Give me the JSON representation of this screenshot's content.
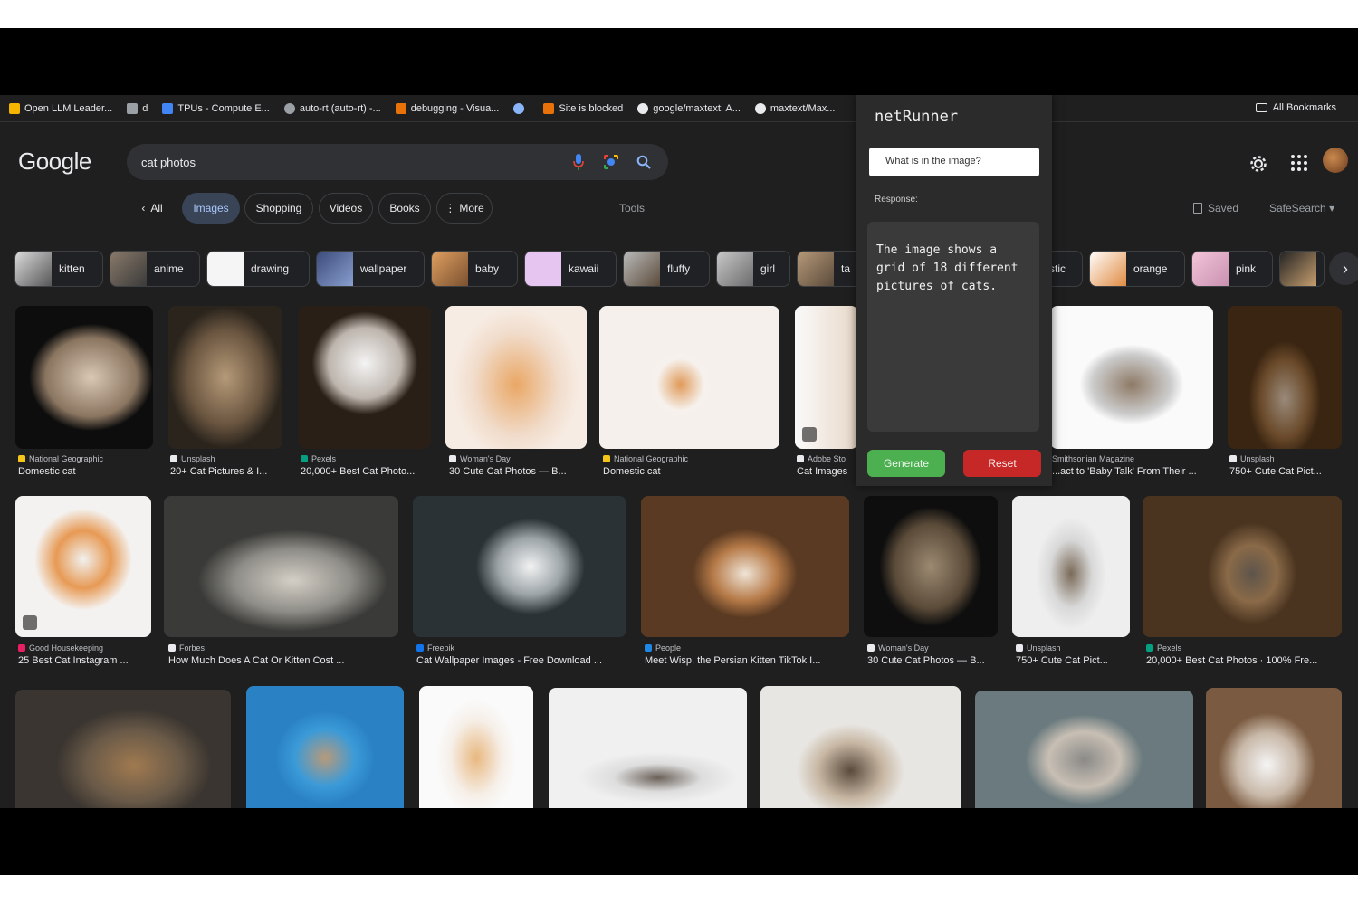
{
  "bookmarks": [
    {
      "label": "Open LLM Leader...",
      "color": "#f5b400"
    },
    {
      "label": "d",
      "color": "#9aa0a6"
    },
    {
      "label": "TPUs - Compute E...",
      "color": "#4285f4"
    },
    {
      "label": "auto-rt (auto-rt) -...",
      "color": "#9aa0a6"
    },
    {
      "label": "debugging - Visua...",
      "color": "#e8710a"
    },
    {
      "label": "",
      "color": "#8ab4f8"
    },
    {
      "label": "Site is blocked",
      "color": "#e8710a"
    },
    {
      "label": "google/maxtext: A...",
      "color": "#e8eaed"
    },
    {
      "label": "maxtext/Max...",
      "color": "#e8eaed"
    }
  ],
  "all_bookmarks": "All Bookmarks",
  "logo": "Google",
  "search": {
    "value": "cat photos"
  },
  "tabs": {
    "all": "All",
    "images": "Images",
    "shopping": "Shopping",
    "videos": "Videos",
    "books": "Books",
    "more": "More",
    "tools": "Tools",
    "saved": "Saved",
    "safesearch": "SafeSearch"
  },
  "chips": [
    "kitten",
    "anime",
    "drawing",
    "wallpaper",
    "baby",
    "kawaii",
    "fluffy",
    "girl",
    "ta",
    "stic",
    "orange",
    "pink"
  ],
  "results": [
    {
      "source": "National Geographic",
      "title": "Domestic cat",
      "src_color": "#f5c518"
    },
    {
      "source": "Unsplash",
      "title": "20+ Cat Pictures & I...",
      "src_color": "#e8eaed"
    },
    {
      "source": "Pexels",
      "title": "20,000+ Best Cat Photo...",
      "src_color": "#05a081"
    },
    {
      "source": "Woman's Day",
      "title": "30 Cute Cat Photos — B...",
      "src_color": "#e8eaed"
    },
    {
      "source": "National Geographic",
      "title": "Domestic cat",
      "src_color": "#f5c518"
    },
    {
      "source": "Adobe Sto",
      "title": "Cat Images",
      "src_color": "#e8eaed"
    },
    {
      "source": "Smithsonian Magazine",
      "title": "...act to 'Baby Talk' From Their ...",
      "src_color": "#e8eaed"
    },
    {
      "source": "Unsplash",
      "title": "750+ Cute Cat Pict...",
      "src_color": "#e8eaed"
    },
    {
      "source": "Good Housekeeping",
      "title": "25 Best Cat Instagram ...",
      "src_color": "#e91e63"
    },
    {
      "source": "Forbes",
      "title": "How Much Does A Cat Or Kitten Cost ...",
      "src_color": "#e8eaed"
    },
    {
      "source": "Freepik",
      "title": "Cat Wallpaper Images - Free Download ...",
      "src_color": "#1273eb"
    },
    {
      "source": "People",
      "title": "Meet Wisp, the Persian Kitten TikTok I...",
      "src_color": "#1e88e5"
    },
    {
      "source": "Woman's Day",
      "title": "30 Cute Cat Photos — B...",
      "src_color": "#e8eaed"
    },
    {
      "source": "Unsplash",
      "title": "750+ Cute Cat Pict...",
      "src_color": "#e8eaed"
    },
    {
      "source": "Pexels",
      "title": "20,000+ Best Cat Photos · 100% Fre...",
      "src_color": "#05a081"
    }
  ],
  "panel": {
    "title": "netRunner",
    "input_value": "What is in the image?",
    "response_label": "Response:",
    "response_text": "The image shows a grid of 18 different pictures of cats.",
    "generate": "Generate",
    "reset": "Reset"
  }
}
